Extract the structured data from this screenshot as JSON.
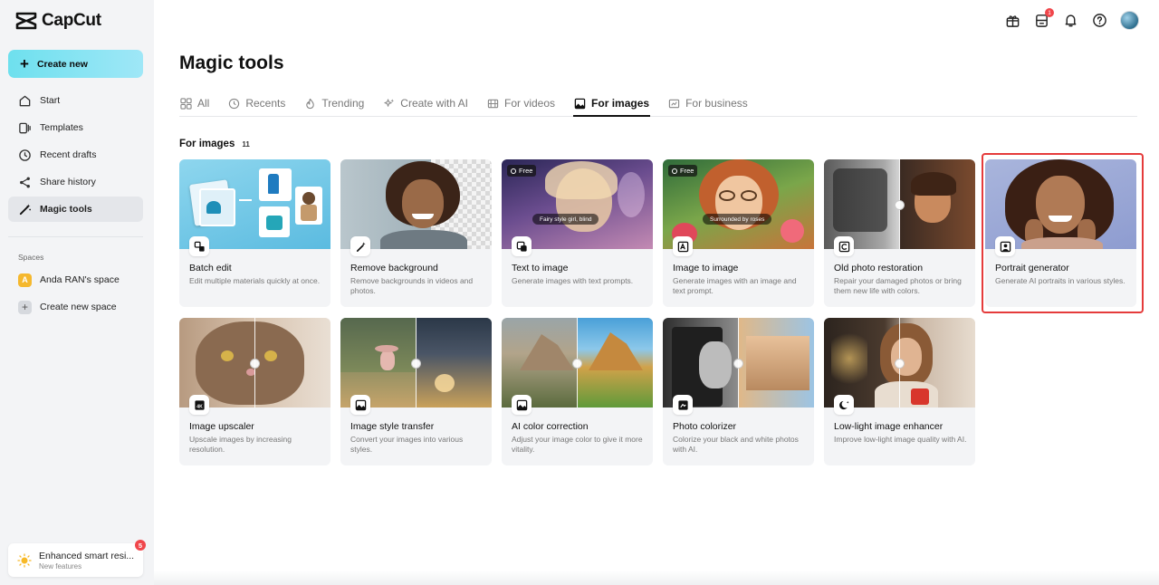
{
  "app": {
    "name": "CapCut"
  },
  "sidebar": {
    "create_label": "Create new",
    "nav": [
      {
        "label": "Start",
        "icon": "home-icon"
      },
      {
        "label": "Templates",
        "icon": "templates-icon"
      },
      {
        "label": "Recent drafts",
        "icon": "clock-icon"
      },
      {
        "label": "Share history",
        "icon": "share-icon"
      },
      {
        "label": "Magic tools",
        "icon": "magic-wand-icon",
        "active": true
      }
    ],
    "spaces_label": "Spaces",
    "space_name": "Anda RAN's space",
    "space_initial": "A",
    "create_space_label": "Create new space",
    "feature": {
      "title": "Enhanced smart resi...",
      "subtitle": "New features",
      "badge": "5"
    }
  },
  "header": {
    "notification_count": "1",
    "icons": [
      "gift-icon",
      "inbox-icon",
      "bell-icon",
      "help-icon",
      "avatar"
    ]
  },
  "main": {
    "title": "Magic tools",
    "tabs": [
      {
        "label": "All",
        "icon": "grid-icon"
      },
      {
        "label": "Recents",
        "icon": "clock-icon"
      },
      {
        "label": "Trending",
        "icon": "flame-icon"
      },
      {
        "label": "Create with AI",
        "icon": "sparkle-icon"
      },
      {
        "label": "For videos",
        "icon": "film-icon"
      },
      {
        "label": "For images",
        "icon": "image-icon",
        "active": true
      },
      {
        "label": "For business",
        "icon": "business-icon"
      }
    ],
    "section": {
      "label": "For images",
      "count": "11"
    },
    "free_label": "Free",
    "tools": [
      {
        "title": "Batch edit",
        "desc": "Edit multiple materials quickly at once.",
        "icon": "batch-edit-icon"
      },
      {
        "title": "Remove background",
        "desc": "Remove backgrounds in videos and photos.",
        "icon": "remove-bg-icon"
      },
      {
        "title": "Text to image",
        "desc": "Generate images with text prompts.",
        "icon": "text-image-icon",
        "caption": "Fairy style girl, blind"
      },
      {
        "title": "Image to image",
        "desc": "Generate images with an image and text prompt.",
        "icon": "image-image-icon",
        "caption": "Surrounded by roses"
      },
      {
        "title": "Old photo restoration",
        "desc": "Repair your damaged photos or bring them new life with colors.",
        "icon": "restore-icon"
      },
      {
        "title": "Portrait generator",
        "desc": "Generate AI portraits in various styles.",
        "icon": "portrait-icon"
      },
      {
        "title": "Image upscaler",
        "desc": "Upscale images by increasing resolution.",
        "icon": "upscale-icon"
      },
      {
        "title": "Image style transfer",
        "desc": "Convert your images into various styles.",
        "icon": "style-icon"
      },
      {
        "title": "AI color correction",
        "desc": "Adjust your image color to give it more vitality.",
        "icon": "color-icon"
      },
      {
        "title": "Photo colorizer",
        "desc": "Colorize your black and white photos with AI.",
        "icon": "colorize-icon"
      },
      {
        "title": "Low-light image enhancer",
        "desc": "Improve low-light image quality with AI.",
        "icon": "moon-icon"
      }
    ]
  }
}
